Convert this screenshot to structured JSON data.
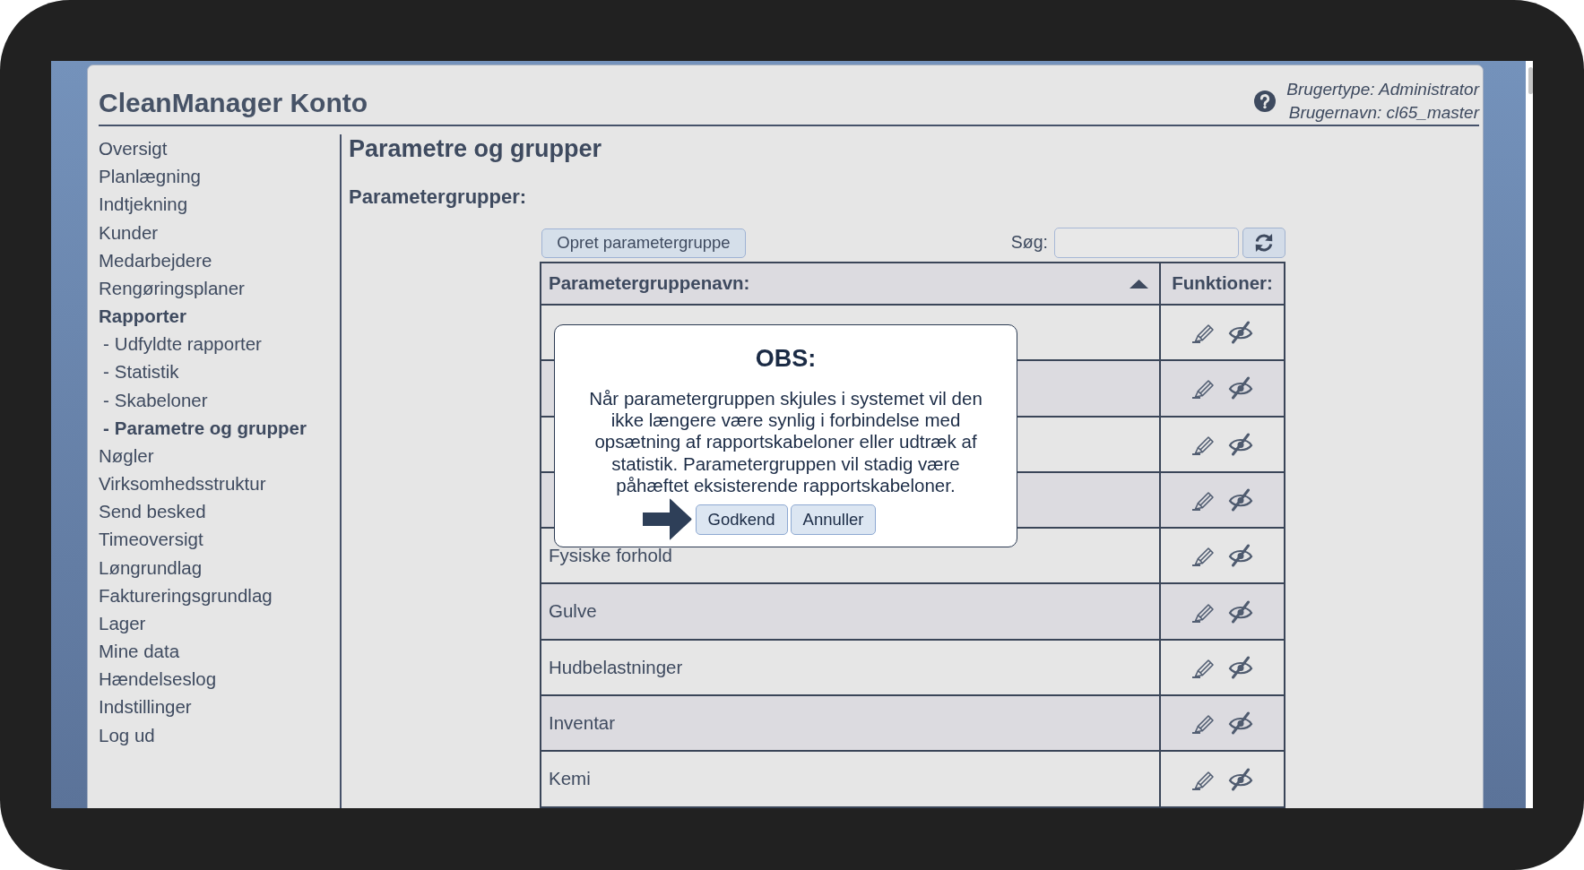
{
  "header": {
    "title": "CleanManager Konto",
    "user_info": [
      "Brugertype: Administrator",
      "Brugernavn: cl65_master"
    ]
  },
  "sidebar": {
    "items": [
      {
        "label": "Oversigt",
        "selected": false
      },
      {
        "label": "Planlægning",
        "selected": false
      },
      {
        "label": "Indtjekning",
        "selected": false
      },
      {
        "label": "Kunder",
        "selected": false
      },
      {
        "label": "Medarbejdere",
        "selected": false
      },
      {
        "label": "Rengøringsplaner",
        "selected": false
      },
      {
        "label": "Rapporter",
        "selected": true,
        "children": [
          {
            "prefix": "-",
            "label": "Udfyldte rapporter",
            "selected": false
          },
          {
            "prefix": "-",
            "label": "Statistik",
            "selected": false
          },
          {
            "prefix": "-",
            "label": "Skabeloner",
            "selected": false
          },
          {
            "prefix": "-",
            "label": "Parametre og grupper",
            "selected": true
          }
        ]
      },
      {
        "label": "Nøgler",
        "selected": false
      },
      {
        "label": "Virksomhedsstruktur",
        "selected": false
      },
      {
        "label": "Send besked",
        "selected": false
      },
      {
        "label": "Timeoversigt",
        "selected": false
      },
      {
        "label": "Løngrundlag",
        "selected": false
      },
      {
        "label": "Faktureringsgrundlag",
        "selected": false
      },
      {
        "label": "Lager",
        "selected": false
      },
      {
        "label": "Mine data",
        "selected": false
      },
      {
        "label": "Hændelseslog",
        "selected": false
      },
      {
        "label": "Indstillinger",
        "selected": false
      },
      {
        "label": "Log ud",
        "selected": false
      }
    ]
  },
  "page": {
    "title": "Parametre og grupper",
    "section_title": "Parametergrupper:"
  },
  "toolbar": {
    "create_button": "Opret parametergruppe",
    "search": {
      "label": "Søg:"
    }
  },
  "table": {
    "columns": [
      {
        "label": "Parametergruppenavn:",
        "sorted_ascending": true
      },
      {
        "label": "Funktioner:"
      }
    ],
    "rows": [
      {},
      {},
      {},
      {},
      {
        "name": "Fysiske forhold"
      },
      {
        "name": "Gulve"
      },
      {
        "name": "Hudbelastninger"
      },
      {
        "name": "Inventar"
      },
      {
        "name": "Kemi"
      }
    ]
  },
  "dialog": {
    "title": "OBS:",
    "message": "Når parametergruppen skjules i systemet vil den ikke længere være synlig i forbindelse med opsætning af rapportskabeloner eller udtræk af statistik. Parametergruppen vil stadig være påhæftet eksisterende rapportskabeloner.",
    "buttons": [
      {
        "label": "Godkend",
        "pointed_at": true
      },
      {
        "label": "Annuller",
        "pointed_at": false
      }
    ]
  }
}
